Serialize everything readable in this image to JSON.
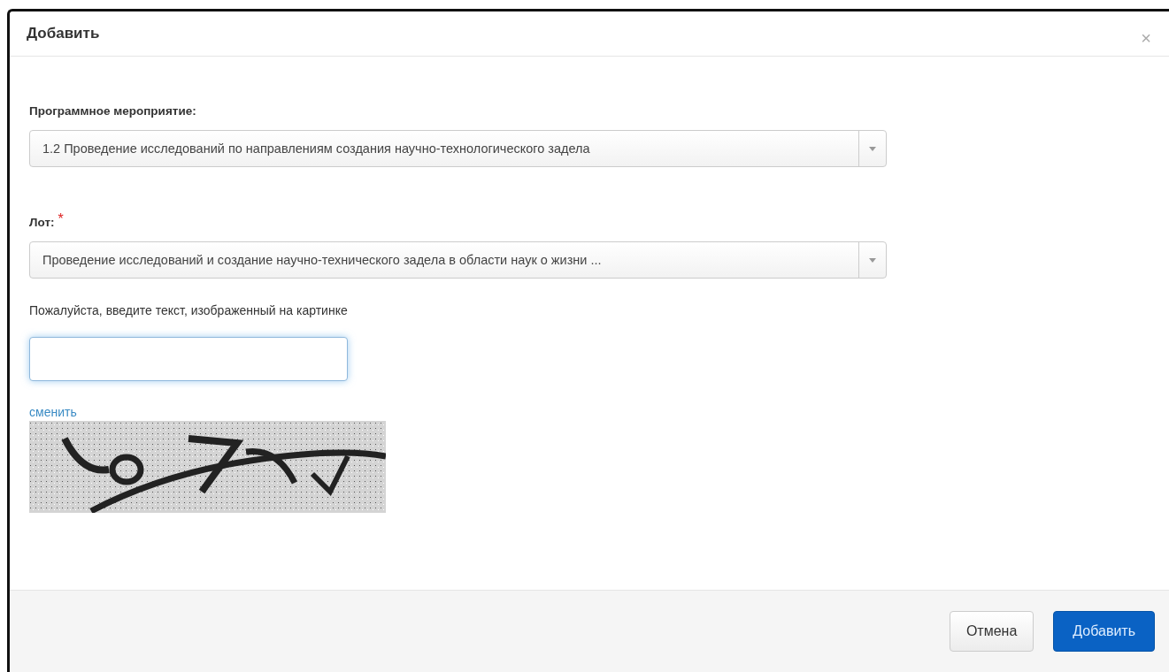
{
  "dialog": {
    "title": "Добавить",
    "close": "×"
  },
  "fields": [
    {
      "kind": "select",
      "label": "Программное мероприятие:",
      "required": false,
      "value": "1.2 Проведение исследований по направлениям создания научно-технологического задела"
    },
    {
      "kind": "select",
      "label": "Лот:",
      "required": true,
      "required_mark": "*",
      "value": "Проведение исследований и создание научно-технического задела в области наук о жизни ..."
    }
  ],
  "captcha": {
    "prompt": "Пожалуйста, введите текст, изображенный на картинке",
    "focused": true,
    "refresh_link": "сменить"
  },
  "buttons": [
    {
      "label": "Отмена",
      "primary": false
    },
    {
      "label": "Добавить",
      "primary": true
    }
  ]
}
